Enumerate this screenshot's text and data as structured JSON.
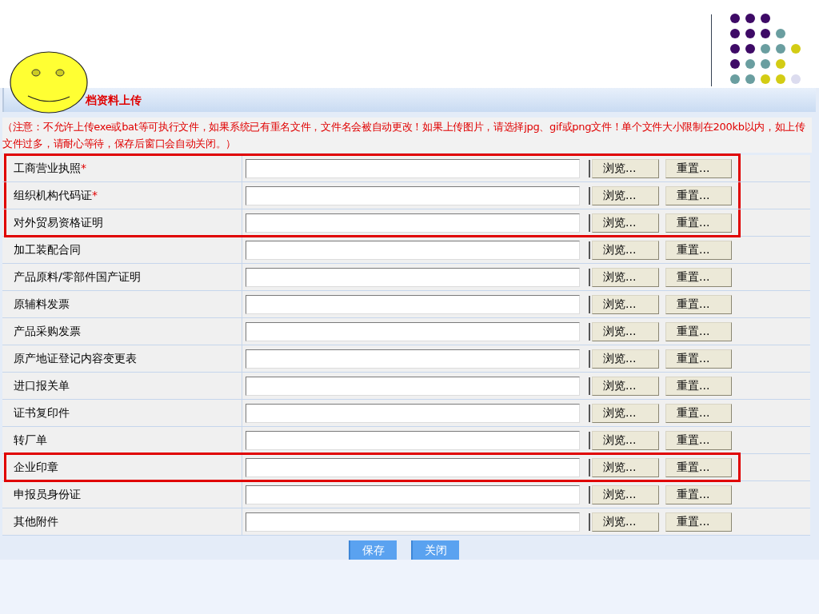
{
  "title": "档资料上传",
  "note": "（注意：不允许上传exe或bat等可执行文件，如果系统已有重名文件，文件名会被自动更改！如果上传图片，请选择jpg、gif或png文件！单个文件大小限制在200kb以内，如上传文件过多，请耐心等待，保存后窗口会自动关闭。）",
  "rows": [
    {
      "label": "工商营业执照",
      "required": true,
      "highlighted": true,
      "browse": "浏览...",
      "reset": "重置..."
    },
    {
      "label": "组织机构代码证",
      "required": true,
      "highlighted": true,
      "browse": "浏览...",
      "reset": "重置..."
    },
    {
      "label": "对外贸易资格证明",
      "required": false,
      "highlighted": true,
      "browse": "浏览...",
      "reset": "重置..."
    },
    {
      "label": "加工装配合同",
      "required": false,
      "highlighted": false,
      "browse": "浏览...",
      "reset": "重置..."
    },
    {
      "label": "产品原料/零部件国产证明",
      "required": false,
      "highlighted": false,
      "browse": "浏览...",
      "reset": "重置..."
    },
    {
      "label": "原辅料发票",
      "required": false,
      "highlighted": false,
      "browse": "浏览...",
      "reset": "重置..."
    },
    {
      "label": "产品采购发票",
      "required": false,
      "highlighted": false,
      "browse": "浏览...",
      "reset": "重置..."
    },
    {
      "label": "原产地证登记内容变更表",
      "required": false,
      "highlighted": false,
      "browse": "浏览...",
      "reset": "重置..."
    },
    {
      "label": "进口报关单",
      "required": false,
      "highlighted": false,
      "browse": "浏览...",
      "reset": "重置..."
    },
    {
      "label": "证书复印件",
      "required": false,
      "highlighted": false,
      "browse": "浏览...",
      "reset": "重置..."
    },
    {
      "label": "转厂单",
      "required": false,
      "highlighted": false,
      "browse": "浏览...",
      "reset": "重置..."
    },
    {
      "label": "企业印章",
      "required": false,
      "highlighted": true,
      "browse": "浏览...",
      "reset": "重置..."
    },
    {
      "label": "申报员身份证",
      "required": false,
      "highlighted": false,
      "browse": "浏览...",
      "reset": "重置..."
    },
    {
      "label": "其他附件",
      "required": false,
      "highlighted": false,
      "browse": "浏览...",
      "reset": "重置..."
    }
  ],
  "required_mark": "*",
  "buttons": [
    {
      "label": "保存"
    },
    {
      "label": "关闭"
    }
  ]
}
